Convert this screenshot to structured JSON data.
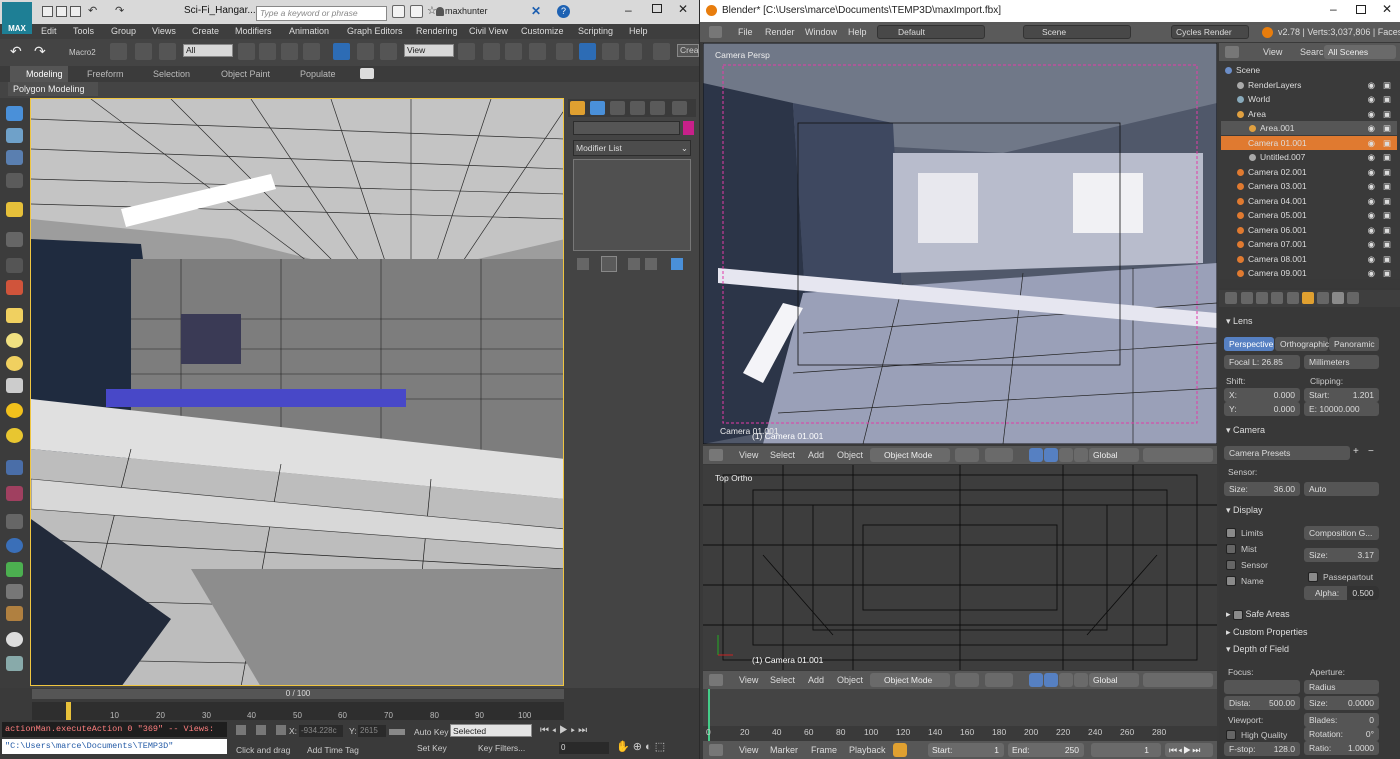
{
  "max": {
    "logo": "MAX",
    "title": "Sci-Fi_Hangar...",
    "search_placeholder": "Type a keyword or phrase",
    "user": "maxhunter",
    "menu": [
      "Edit",
      "Tools",
      "Group",
      "Views",
      "Create",
      "Modifiers",
      "Animation",
      "Graph Editors",
      "Rendering",
      "Civil View",
      "Customize",
      "Scripting",
      "Help"
    ],
    "toolbar": {
      "macro": "Macro2",
      "filter": "All",
      "view": "View",
      "create_sel": "Crea"
    },
    "ribbon_tabs": [
      "Modeling",
      "Freeform",
      "Selection",
      "Object Paint",
      "Populate"
    ],
    "ribbon_active": "Modeling",
    "poly_modeling": "Polygon Modeling",
    "modifier_list": "Modifier List",
    "time_slider": "0 / 100",
    "ruler_ticks": [
      "10",
      "20",
      "30",
      "40",
      "50",
      "60",
      "70",
      "80",
      "90",
      "100"
    ],
    "maxscript_output": "actionMan.executeAction 0 \"369\"  -- Views:",
    "maxscript_input": "\"C:\\Users\\marce\\Documents\\TEMP3D\"",
    "status": {
      "click_drag": "Click and drag",
      "x_label": "X:",
      "x_value": "-934.228c",
      "y_label": "Y:",
      "y_value": "2615",
      "add_time_tag": "Add Time Tag",
      "auto_key": "Auto Key",
      "set_key": "Set Key",
      "selected": "Selected",
      "key_filters": "Key Filters...",
      "frame": "0"
    }
  },
  "blender": {
    "title": "Blender* [C:\\Users\\marce\\Documents\\TEMP3D\\maxImport.fbx]",
    "menu": [
      "File",
      "Render",
      "Window",
      "Help"
    ],
    "layout": "Default",
    "scene": "Scene",
    "engine": "Cycles Render",
    "stats": "v2.78 | Verts:3,037,806 | Faces",
    "camera_vp": {
      "label": "Camera Persp",
      "object": "Camera 01.001",
      "object2": "(1) Camera 01.001"
    },
    "vp_header": {
      "items": [
        "View",
        "Select",
        "Add",
        "Object"
      ],
      "mode": "Object Mode",
      "orient": "Global"
    },
    "top_vp": {
      "label": "Top Ortho",
      "object": "(1) Camera 01.001"
    },
    "timeline_ticks": [
      "0",
      "20",
      "40",
      "60",
      "80",
      "100",
      "120",
      "140",
      "160",
      "180",
      "200",
      "220",
      "240",
      "260",
      "280"
    ],
    "timeline_hdr": {
      "items": [
        "View",
        "Marker",
        "Frame",
        "Playback"
      ],
      "start_label": "Start:",
      "start": "1",
      "end_label": "End:",
      "end": "250",
      "current": "1"
    },
    "outliner": {
      "tabs": [
        "View",
        "Search",
        "All Scenes"
      ],
      "rows": [
        {
          "label": "Scene",
          "indent": 0,
          "color": "#6c8ec8"
        },
        {
          "label": "RenderLayers",
          "indent": 1,
          "color": "#aaa"
        },
        {
          "label": "World",
          "indent": 1,
          "color": "#8ab"
        },
        {
          "label": "Area",
          "indent": 1,
          "color": "#e0a040"
        },
        {
          "label": "Area.001",
          "indent": 2,
          "color": "#e0a040",
          "selected": true
        },
        {
          "label": "Camera 01.001",
          "indent": 1,
          "color": "#e07a30",
          "highlight": true
        },
        {
          "label": "Untitled.007",
          "indent": 2,
          "color": "#aaa"
        },
        {
          "label": "Camera 02.001",
          "indent": 1,
          "color": "#e07a30"
        },
        {
          "label": "Camera 03.001",
          "indent": 1,
          "color": "#e07a30"
        },
        {
          "label": "Camera 04.001",
          "indent": 1,
          "color": "#e07a30"
        },
        {
          "label": "Camera 05.001",
          "indent": 1,
          "color": "#e07a30"
        },
        {
          "label": "Camera 06.001",
          "indent": 1,
          "color": "#e07a30"
        },
        {
          "label": "Camera 07.001",
          "indent": 1,
          "color": "#e07a30"
        },
        {
          "label": "Camera 08.001",
          "indent": 1,
          "color": "#e07a30"
        },
        {
          "label": "Camera 09.001",
          "indent": 1,
          "color": "#e07a30"
        }
      ]
    },
    "props": {
      "lens": "Lens",
      "lens_tabs": [
        "Perspective",
        "Orthographic",
        "Panoramic"
      ],
      "focal": "Focal L: 26.85",
      "units": "Millimeters",
      "shift": "Shift:",
      "clipping": "Clipping:",
      "shift_x": "X:",
      "shift_x_val": "0.000",
      "shift_y": "Y:",
      "shift_y_val": "0.000",
      "clip_start": "Start:",
      "clip_start_val": "1.201",
      "clip_end": "E: 10000.000",
      "camera": "Camera",
      "presets": "Camera Presets",
      "sensor": "Sensor:",
      "size_label": "Size:",
      "size_val": "36.00",
      "auto": "Auto",
      "display": "Display",
      "limits": "Limits",
      "mist": "Mist",
      "sensor_chk": "Sensor",
      "name_chk": "Name",
      "composition": "Composition G...",
      "disp_size_label": "Size:",
      "disp_size_val": "3.17",
      "passepartout": "Passepartout",
      "alpha_label": "Alpha:",
      "alpha_val": "0.500",
      "safe_areas": "Safe Areas",
      "custom_props": "Custom Properties",
      "dof": "Depth of Field",
      "focus": "Focus:",
      "aperture": "Aperture:",
      "radius": "Radius",
      "dist_label": "Dista:",
      "dist_val": "500.00",
      "ap_size_label": "Size:",
      "ap_size_val": "0.0000",
      "viewport": "Viewport:",
      "blades_label": "Blades:",
      "blades_val": "0",
      "high_quality": "High Quality",
      "rotation_label": "Rotation:",
      "rotation_val": "0°",
      "fstop_label": "F-stop:",
      "fstop_val": "128.0",
      "ratio_label": "Ratio:",
      "ratio_val": "1.0000"
    }
  }
}
